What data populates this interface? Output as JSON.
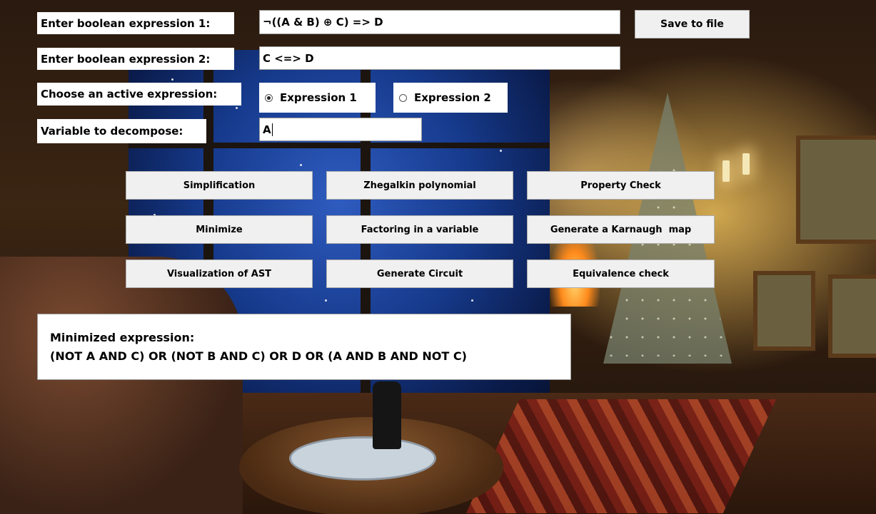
{
  "inputs": {
    "expr1_label": "Enter boolean expression 1:",
    "expr1_value": "¬((A & B) ⊕ C) => D",
    "expr2_label": "Enter boolean expression 2:",
    "expr2_value": "C <=> D",
    "active_label": "Choose an active expression:",
    "variable_label": "Variable to decompose:",
    "variable_value": "A"
  },
  "radio": {
    "option1": "Expression 1",
    "option2": "Expression 2",
    "selected": "Expression 1"
  },
  "buttons": {
    "save": "Save to file",
    "simplification": "Simplification",
    "zhegalkin": "Zhegalkin polynomial",
    "property_check": "Property Check",
    "minimize": "Minimize",
    "factoring": "Factoring in a variable",
    "karnaugh": "Generate a Karnaugh  map",
    "visualization": "Visualization of AST",
    "circuit": "Generate Circuit",
    "equivalence": "Equivalence check"
  },
  "result": {
    "title": "Minimized expression:",
    "value": "(NOT A AND C) OR (NOT B AND C) OR D OR (A AND B AND NOT C)"
  }
}
